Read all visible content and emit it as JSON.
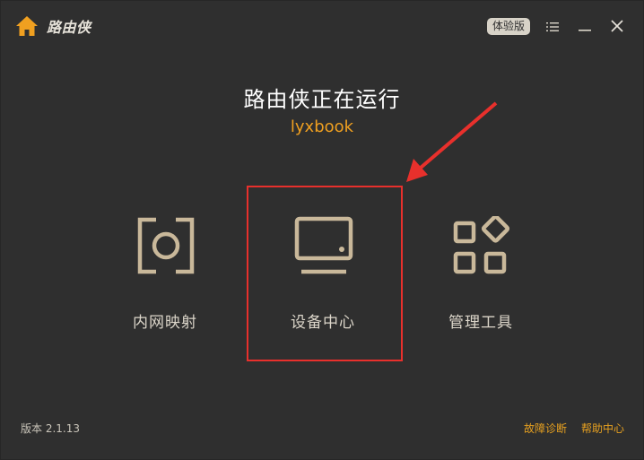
{
  "app": {
    "name": "路由侠",
    "badge": "体验版"
  },
  "status": {
    "title": "路由侠正在运行",
    "account": "lyxbook"
  },
  "features": [
    {
      "label": "内网映射",
      "icon": "target-square-icon"
    },
    {
      "label": "设备中心",
      "icon": "monitor-icon"
    },
    {
      "label": "管理工具",
      "icon": "apps-grid-icon"
    }
  ],
  "footer": {
    "version": "版本 2.1.13",
    "diagnose_label": "故障诊断",
    "help_label": "帮助中心"
  },
  "colors": {
    "background": "#2f2f2f",
    "accent": "#f0a020",
    "icon": "#c9b89a",
    "annotation": "#e8302c"
  },
  "icons": {
    "home": "home-icon",
    "menu": "menu-icon",
    "minimize": "minimize-icon",
    "close": "close-icon"
  },
  "annotation": {
    "highlighted_feature": "设备中心"
  }
}
